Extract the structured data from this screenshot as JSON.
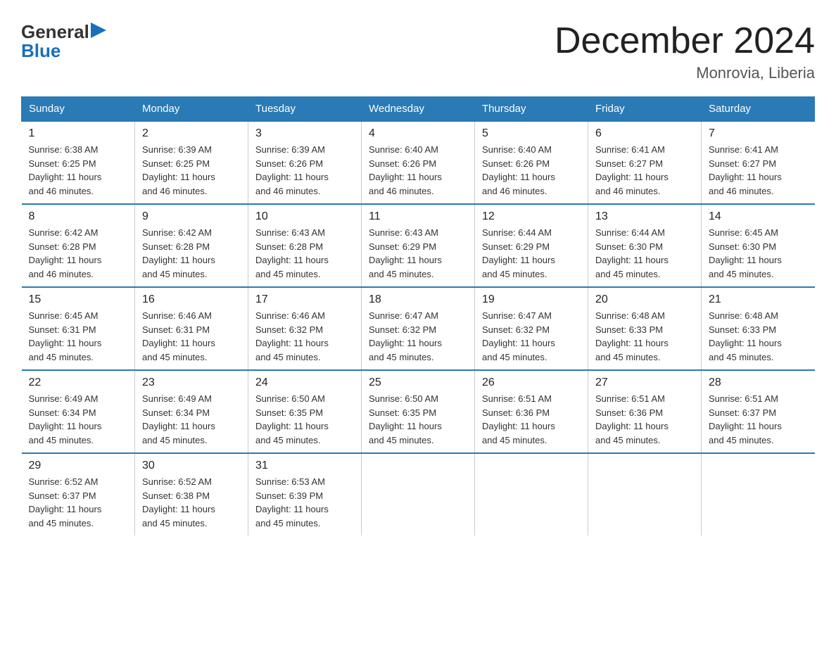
{
  "logo": {
    "general": "General",
    "blue": "Blue"
  },
  "title": "December 2024",
  "subtitle": "Monrovia, Liberia",
  "days_of_week": [
    "Sunday",
    "Monday",
    "Tuesday",
    "Wednesday",
    "Thursday",
    "Friday",
    "Saturday"
  ],
  "weeks": [
    [
      {
        "num": "1",
        "sunrise": "6:38 AM",
        "sunset": "6:25 PM",
        "daylight": "11 hours and 46 minutes."
      },
      {
        "num": "2",
        "sunrise": "6:39 AM",
        "sunset": "6:25 PM",
        "daylight": "11 hours and 46 minutes."
      },
      {
        "num": "3",
        "sunrise": "6:39 AM",
        "sunset": "6:26 PM",
        "daylight": "11 hours and 46 minutes."
      },
      {
        "num": "4",
        "sunrise": "6:40 AM",
        "sunset": "6:26 PM",
        "daylight": "11 hours and 46 minutes."
      },
      {
        "num": "5",
        "sunrise": "6:40 AM",
        "sunset": "6:26 PM",
        "daylight": "11 hours and 46 minutes."
      },
      {
        "num": "6",
        "sunrise": "6:41 AM",
        "sunset": "6:27 PM",
        "daylight": "11 hours and 46 minutes."
      },
      {
        "num": "7",
        "sunrise": "6:41 AM",
        "sunset": "6:27 PM",
        "daylight": "11 hours and 46 minutes."
      }
    ],
    [
      {
        "num": "8",
        "sunrise": "6:42 AM",
        "sunset": "6:28 PM",
        "daylight": "11 hours and 46 minutes."
      },
      {
        "num": "9",
        "sunrise": "6:42 AM",
        "sunset": "6:28 PM",
        "daylight": "11 hours and 45 minutes."
      },
      {
        "num": "10",
        "sunrise": "6:43 AM",
        "sunset": "6:28 PM",
        "daylight": "11 hours and 45 minutes."
      },
      {
        "num": "11",
        "sunrise": "6:43 AM",
        "sunset": "6:29 PM",
        "daylight": "11 hours and 45 minutes."
      },
      {
        "num": "12",
        "sunrise": "6:44 AM",
        "sunset": "6:29 PM",
        "daylight": "11 hours and 45 minutes."
      },
      {
        "num": "13",
        "sunrise": "6:44 AM",
        "sunset": "6:30 PM",
        "daylight": "11 hours and 45 minutes."
      },
      {
        "num": "14",
        "sunrise": "6:45 AM",
        "sunset": "6:30 PM",
        "daylight": "11 hours and 45 minutes."
      }
    ],
    [
      {
        "num": "15",
        "sunrise": "6:45 AM",
        "sunset": "6:31 PM",
        "daylight": "11 hours and 45 minutes."
      },
      {
        "num": "16",
        "sunrise": "6:46 AM",
        "sunset": "6:31 PM",
        "daylight": "11 hours and 45 minutes."
      },
      {
        "num": "17",
        "sunrise": "6:46 AM",
        "sunset": "6:32 PM",
        "daylight": "11 hours and 45 minutes."
      },
      {
        "num": "18",
        "sunrise": "6:47 AM",
        "sunset": "6:32 PM",
        "daylight": "11 hours and 45 minutes."
      },
      {
        "num": "19",
        "sunrise": "6:47 AM",
        "sunset": "6:32 PM",
        "daylight": "11 hours and 45 minutes."
      },
      {
        "num": "20",
        "sunrise": "6:48 AM",
        "sunset": "6:33 PM",
        "daylight": "11 hours and 45 minutes."
      },
      {
        "num": "21",
        "sunrise": "6:48 AM",
        "sunset": "6:33 PM",
        "daylight": "11 hours and 45 minutes."
      }
    ],
    [
      {
        "num": "22",
        "sunrise": "6:49 AM",
        "sunset": "6:34 PM",
        "daylight": "11 hours and 45 minutes."
      },
      {
        "num": "23",
        "sunrise": "6:49 AM",
        "sunset": "6:34 PM",
        "daylight": "11 hours and 45 minutes."
      },
      {
        "num": "24",
        "sunrise": "6:50 AM",
        "sunset": "6:35 PM",
        "daylight": "11 hours and 45 minutes."
      },
      {
        "num": "25",
        "sunrise": "6:50 AM",
        "sunset": "6:35 PM",
        "daylight": "11 hours and 45 minutes."
      },
      {
        "num": "26",
        "sunrise": "6:51 AM",
        "sunset": "6:36 PM",
        "daylight": "11 hours and 45 minutes."
      },
      {
        "num": "27",
        "sunrise": "6:51 AM",
        "sunset": "6:36 PM",
        "daylight": "11 hours and 45 minutes."
      },
      {
        "num": "28",
        "sunrise": "6:51 AM",
        "sunset": "6:37 PM",
        "daylight": "11 hours and 45 minutes."
      }
    ],
    [
      {
        "num": "29",
        "sunrise": "6:52 AM",
        "sunset": "6:37 PM",
        "daylight": "11 hours and 45 minutes."
      },
      {
        "num": "30",
        "sunrise": "6:52 AM",
        "sunset": "6:38 PM",
        "daylight": "11 hours and 45 minutes."
      },
      {
        "num": "31",
        "sunrise": "6:53 AM",
        "sunset": "6:39 PM",
        "daylight": "11 hours and 45 minutes."
      },
      null,
      null,
      null,
      null
    ]
  ],
  "labels": {
    "sunrise": "Sunrise:",
    "sunset": "Sunset:",
    "daylight": "Daylight:"
  }
}
